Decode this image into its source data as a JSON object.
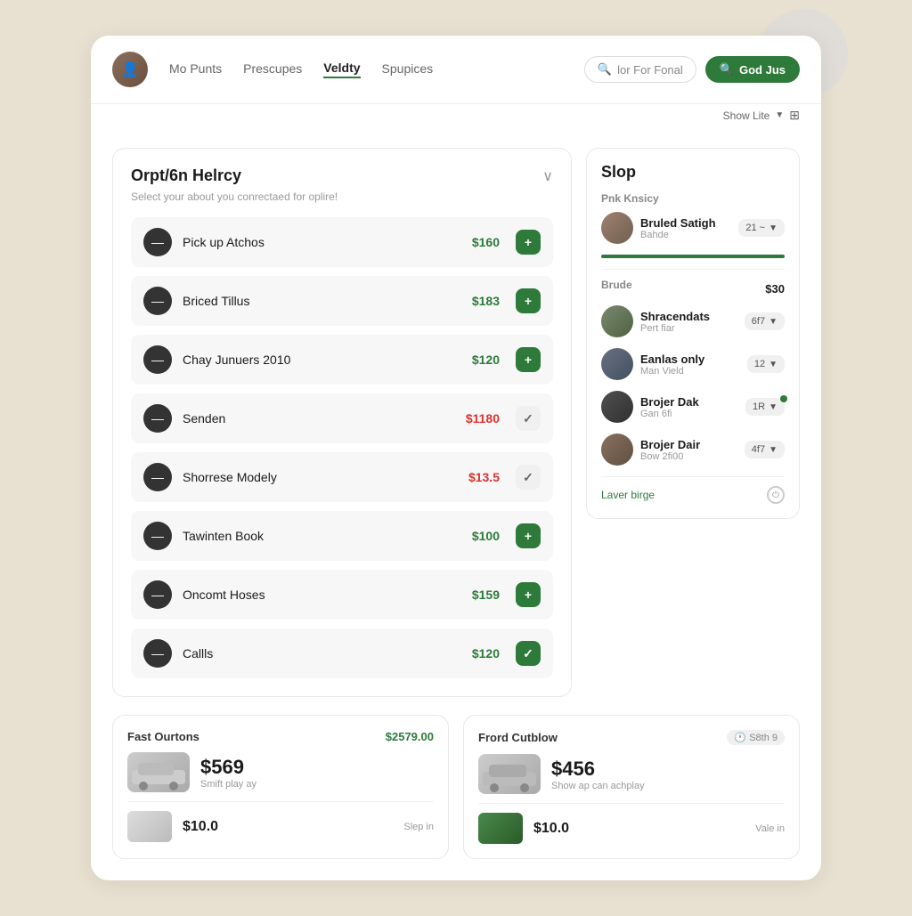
{
  "header": {
    "nav_items": [
      {
        "label": "Mo Punts",
        "active": false
      },
      {
        "label": "Prescupes",
        "active": false
      },
      {
        "label": "Veldty",
        "active": true
      },
      {
        "label": "Spupices",
        "active": false
      }
    ],
    "search_placeholder": "lor For Fonal",
    "search_btn_label": "God Jus",
    "show_lite_label": "Show Lite"
  },
  "left_panel": {
    "section_title": "Orpt/6n Helrcy",
    "section_subtitle": "Select your about you conrectaed for oplire!",
    "services": [
      {
        "name": "Pick up Atchos",
        "price": "$160",
        "price_color": "green",
        "action": "plus"
      },
      {
        "name": "Briced Tillus",
        "price": "$183",
        "price_color": "green",
        "action": "plus"
      },
      {
        "name": "Chay Junuers 2010",
        "price": "$120",
        "price_color": "green",
        "action": "plus"
      },
      {
        "name": "Senden",
        "price": "$1180",
        "price_color": "red",
        "action": "minus"
      },
      {
        "name": "Shorrese Modely",
        "price": "$13.5",
        "price_color": "red",
        "action": "minus"
      },
      {
        "name": "Tawinten Book",
        "price": "$100",
        "price_color": "green",
        "action": "plus"
      },
      {
        "name": "Oncomt Hoses",
        "price": "$159",
        "price_color": "green",
        "action": "plus"
      },
      {
        "name": "Callls",
        "price": "$120",
        "price_color": "green",
        "action": "check"
      }
    ]
  },
  "bottom_cards": [
    {
      "title": "Fast Ourtons",
      "header_price": "$2579.00",
      "car_price": "$569",
      "car_desc": "Smift play ay",
      "car2_price": "$10.0",
      "car2_sub": "Slep in"
    },
    {
      "title": "Frord Cutblow",
      "badge": "S8th 9",
      "car_price": "$456",
      "car_desc": "Show ap can achplay",
      "car2_price": "$10.0",
      "car2_sub": "Vale in"
    }
  ],
  "right_panel": {
    "title": "Slop",
    "top_section_label": "Pnk Knsicy",
    "top_person": {
      "name": "Bruled Satigh",
      "sub": "Bahde",
      "action": "21 ~"
    },
    "section2_label": "Brude",
    "section2_price": "$30",
    "persons": [
      {
        "name": "Shracendats",
        "sub": "Pert fiar",
        "action": "6f7",
        "has_dot": false
      },
      {
        "name": "Eanlas only",
        "sub": "Man Vield",
        "action": "12",
        "has_dot": false
      },
      {
        "name": "Brojer Dak",
        "sub": "Gan 6fi",
        "action": "1R",
        "has_dot": true
      },
      {
        "name": "Brojer Dair",
        "sub": "Bow 2fi00",
        "action": "4f7",
        "has_dot": false
      }
    ],
    "bottom_link": "Laver birge"
  }
}
